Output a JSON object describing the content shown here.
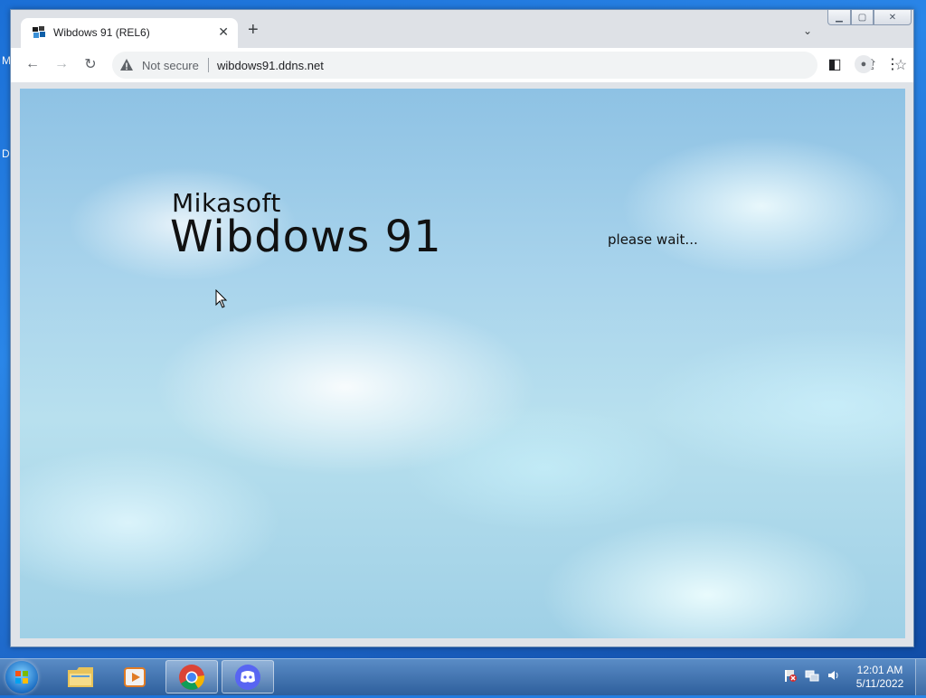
{
  "desktop": {
    "edge_letters": [
      "M",
      "D"
    ]
  },
  "browser": {
    "tab": {
      "title": "Wibdows 91 (REL6)",
      "close_glyph": "✕"
    },
    "new_tab_glyph": "+",
    "tab_search_glyph": "⌄",
    "window_controls": {
      "minimize": "▁",
      "maximize": "▢",
      "close": "✕"
    },
    "toolbar": {
      "back_glyph": "←",
      "forward_glyph": "→",
      "reload_glyph": "↻",
      "security_label": "Not secure",
      "url": "wibdows91.ddns.net",
      "share_glyph": "⇪",
      "star_glyph": "☆",
      "sidepanel_glyph": "◧",
      "profile_glyph": "●",
      "menu_glyph": "⋮"
    }
  },
  "page": {
    "brand_small": "Mikasoft",
    "brand_big": "Wibdows 91",
    "status": "please wait..."
  },
  "taskbar": {
    "apps": [
      "start-orb",
      "file-explorer",
      "media-player",
      "chrome",
      "discord"
    ],
    "clock_time": "12:01 AM",
    "clock_date": "5/11/2022"
  },
  "colors": {
    "taskbar": "#2e5f9c",
    "sky": "#9fd0e6"
  }
}
